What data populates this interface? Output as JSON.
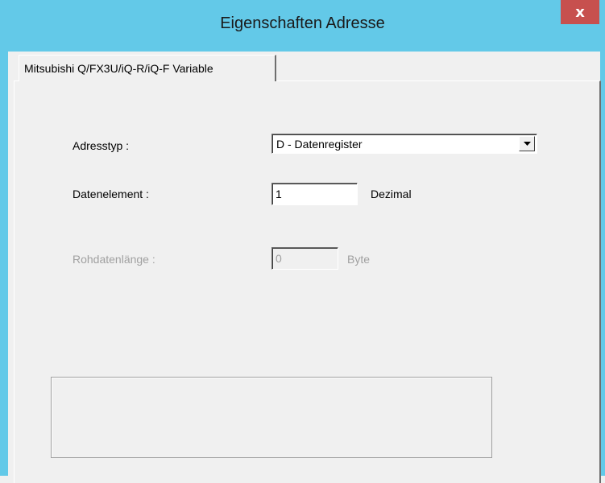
{
  "window": {
    "title": "Eigenschaften Adresse",
    "close_glyph": "x"
  },
  "tabs": [
    {
      "label": "Mitsubishi Q/FX3U/iQ-R/iQ-F Variable",
      "active": true
    }
  ],
  "form": {
    "address_type": {
      "label": "Adresstyp :",
      "selected": "D - Datenregister"
    },
    "data_element": {
      "label": "Datenelement :",
      "value": "1",
      "unit": "Dezimal"
    },
    "raw_data_length": {
      "label": "Rohdatenlänge :",
      "value": "0",
      "unit": "Byte",
      "enabled": false
    }
  },
  "colors": {
    "titlebar": "#63c9e8",
    "close_button": "#c7504e",
    "dialog_background": "#f0f0f0",
    "disabled_text": "#a0a0a0"
  }
}
